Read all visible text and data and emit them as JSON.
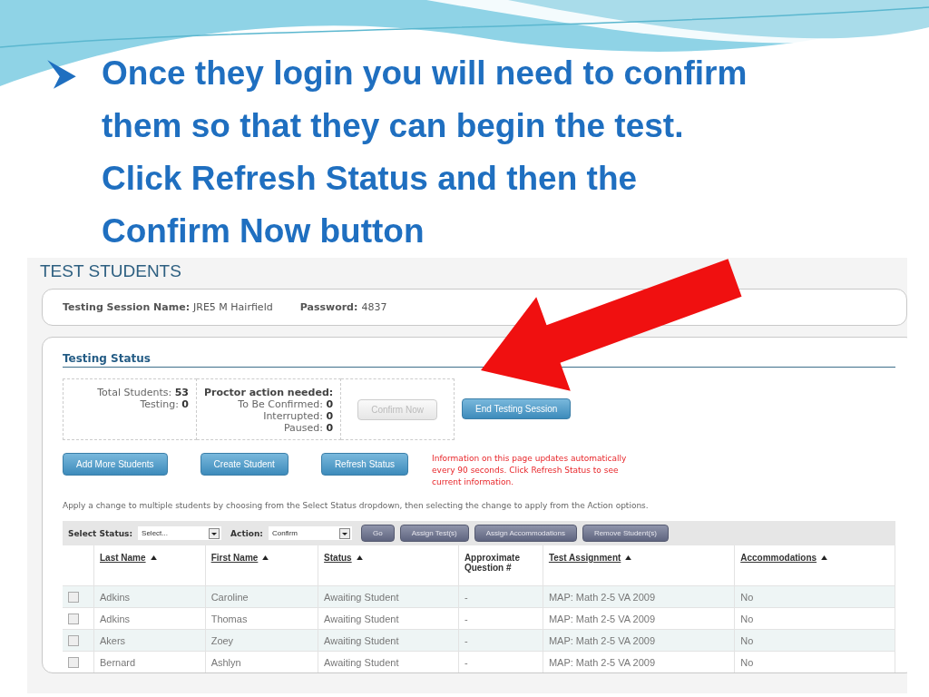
{
  "slide": {
    "bullet_lines": [
      "Once they login you will need to confirm",
      "them so that they can begin the test.",
      "Click Refresh Status and then the",
      "Confirm Now button"
    ]
  },
  "screen": {
    "title": "TEST STUDENTS",
    "session": {
      "name_label": "Testing Session Name:",
      "name": "JRE5 M Hairfield",
      "password_label": "Password:",
      "password": "4837"
    },
    "status": {
      "heading": "Testing Status",
      "totals": [
        {
          "label": "Total Students:",
          "value": "53"
        },
        {
          "label": "Testing:",
          "value": "0"
        }
      ],
      "proctor_heading": "Proctor action needed:",
      "proctor": [
        {
          "label": "To Be Confirmed:",
          "value": "0"
        },
        {
          "label": "Interrupted:",
          "value": "0"
        },
        {
          "label": "Paused:",
          "value": "0"
        }
      ],
      "buttons": [
        {
          "label": "Confirm Now",
          "disabled": true
        },
        {
          "label": "End Testing Session",
          "disabled": false
        }
      ]
    },
    "actions": [
      "Add More Students",
      "Create Student",
      "Refresh Status"
    ],
    "notice": "Information on this page updates automatically every 90 seconds. Click Refresh Status to see current information.",
    "instruction": "Apply a change to multiple students by choosing from the Select Status dropdown, then selecting the change to apply from the Action options.",
    "toolbar": {
      "status_label": "Select Status:",
      "status_value": "Select...",
      "action_label": "Action:",
      "action_value": "Confirm",
      "buttons": [
        "Go",
        "Assign Test(s)",
        "Assign Accommodations",
        "Remove Student(s)"
      ]
    },
    "table": {
      "columns": [
        {
          "label": "Last Name",
          "sortable": true
        },
        {
          "label": "First Name",
          "sortable": true
        },
        {
          "label": "Status",
          "sortable": true
        },
        {
          "label": "Approximate Question #",
          "sortable": false
        },
        {
          "label": "Test Assignment",
          "sortable": true
        },
        {
          "label": "Accommodations",
          "sortable": true
        }
      ],
      "rows": [
        {
          "checked": false,
          "cells": [
            "Adkins",
            "Caroline",
            "Awaiting Student",
            "-",
            "MAP: Math 2-5 VA 2009",
            "No"
          ]
        },
        {
          "checked": false,
          "cells": [
            "Adkins",
            "Thomas",
            "Awaiting Student",
            "-",
            "MAP: Math 2-5 VA 2009",
            "No"
          ]
        },
        {
          "checked": false,
          "cells": [
            "Akers",
            "Zoey",
            "Awaiting Student",
            "-",
            "MAP: Math 2-5 VA 2009",
            "No"
          ]
        },
        {
          "checked": false,
          "cells": [
            "Bernard",
            "Ashlyn",
            "Awaiting Student",
            "-",
            "MAP: Math 2-5 VA 2009",
            "No"
          ]
        }
      ]
    }
  }
}
